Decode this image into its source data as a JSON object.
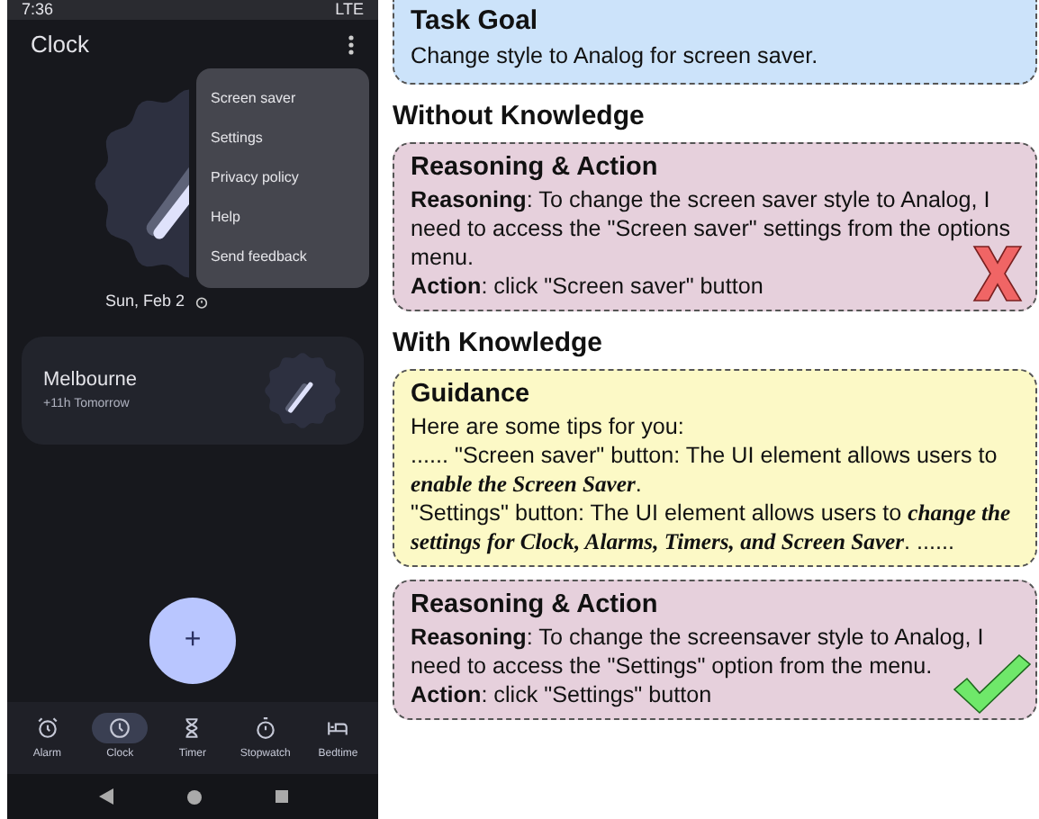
{
  "phone": {
    "status_bar": {
      "time": "7:36",
      "network": "LTE"
    },
    "app_bar": {
      "title": "Clock"
    },
    "date": "Sun, Feb 2",
    "cities": [
      {
        "name": "Melbourne",
        "offset": "+11h Tomorrow"
      }
    ],
    "menu": [
      "Screen saver",
      "Settings",
      "Privacy policy",
      "Help",
      "Send feedback"
    ],
    "fab": {
      "label": "+"
    },
    "nav": [
      {
        "kind": "alarm",
        "label": "Alarm",
        "selected": false
      },
      {
        "kind": "clock",
        "label": "Clock",
        "selected": true
      },
      {
        "kind": "timer",
        "label": "Timer",
        "selected": false
      },
      {
        "kind": "stopwatch",
        "label": "Stopwatch",
        "selected": false
      },
      {
        "kind": "bedtime",
        "label": "Bedtime",
        "selected": false
      }
    ]
  },
  "task_goal": {
    "title": "Task Goal",
    "text": "Change style to Analog for screen saver."
  },
  "sections": [
    {
      "heading": "Without Knowledge",
      "panels": [
        {
          "kind": "reasoning",
          "title": "Reasoning & Action",
          "lines": [
            "**Reasoning**: To change the screen saver style to Analog, I need to access the \"Screen saver\" settings from the options menu.",
            "**Action**: click \"Screen saver\" button"
          ],
          "correct": false
        }
      ]
    },
    {
      "heading": "With Knowledge",
      "panels": [
        {
          "kind": "guidance",
          "title": "Guidance",
          "lines": [
            "Here are some tips for you:",
            "...... \"Screen saver\" button: The UI element allows users to *enable the Screen Saver*.",
            "\"Settings\" button: The UI element allows users to *change the settings for Clock, Alarms, Timers, and Screen Saver*. ......"
          ]
        },
        {
          "kind": "reasoning",
          "title": "Reasoning & Action",
          "lines": [
            "**Reasoning**: To change the screensaver style to Analog, I need to access the \"Settings\" option from the menu.",
            "**Action**: click \"Settings\" button"
          ],
          "correct": true
        }
      ]
    }
  ]
}
